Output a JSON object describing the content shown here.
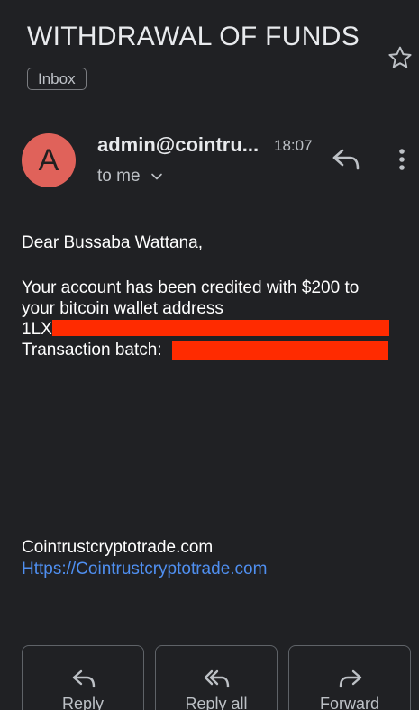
{
  "email": {
    "subject": "WITHDRAWAL OF FUNDS",
    "label": "Inbox",
    "sender": "admin@cointru...",
    "avatar_letter": "A",
    "time": "18:07",
    "recipient": "to me"
  },
  "body": {
    "greeting": "Dear Bussaba Wattana,",
    "line1": "Your account has been credited with $200 to",
    "line2": "your bitcoin wallet address",
    "address_prefix": "1LX",
    "batch_label": "Transaction batch:"
  },
  "signature": {
    "site": "Cointrustcryptotrade.com",
    "link": "Https://Cointrustcryptotrade.com"
  },
  "actions": {
    "reply": "Reply",
    "reply_all": "Reply all",
    "forward": "Forward"
  },
  "colors": {
    "background": "#202124",
    "avatar": "#e0625a",
    "redaction": "#ff2b00",
    "link": "#4f8ff0"
  }
}
